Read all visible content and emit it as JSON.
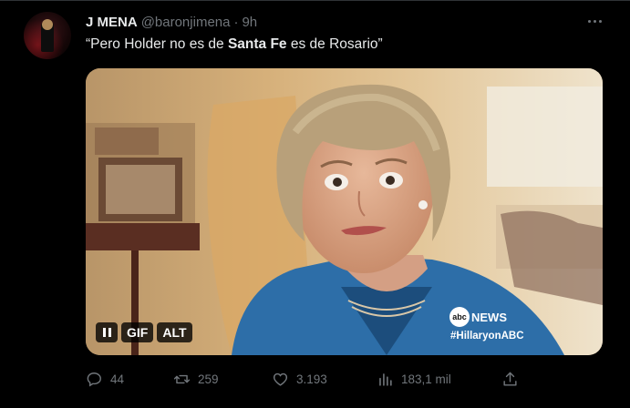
{
  "tweet": {
    "display_name": "J MENA",
    "handle": "@baronjimena",
    "separator": "·",
    "time": "9h",
    "text_before": "“Pero Holder no es de ",
    "text_bold": "Santa Fe",
    "text_after": " es de Rosario”"
  },
  "media": {
    "badges": {
      "gif": "GIF",
      "alt": "ALT"
    },
    "logo_abc": "abc",
    "logo_news": "NEWS",
    "hashtag": "#HillaryonABC"
  },
  "actions": {
    "replies": "44",
    "retweets": "259",
    "likes": "3.193",
    "views": "183,1 mil"
  },
  "icons": [
    "more-icon",
    "pause-icon",
    "reply-icon",
    "retweet-icon",
    "like-icon",
    "views-icon",
    "share-icon"
  ],
  "colors": {
    "background": "#000000",
    "text": "#e7e9ea",
    "secondary": "#71767b"
  }
}
